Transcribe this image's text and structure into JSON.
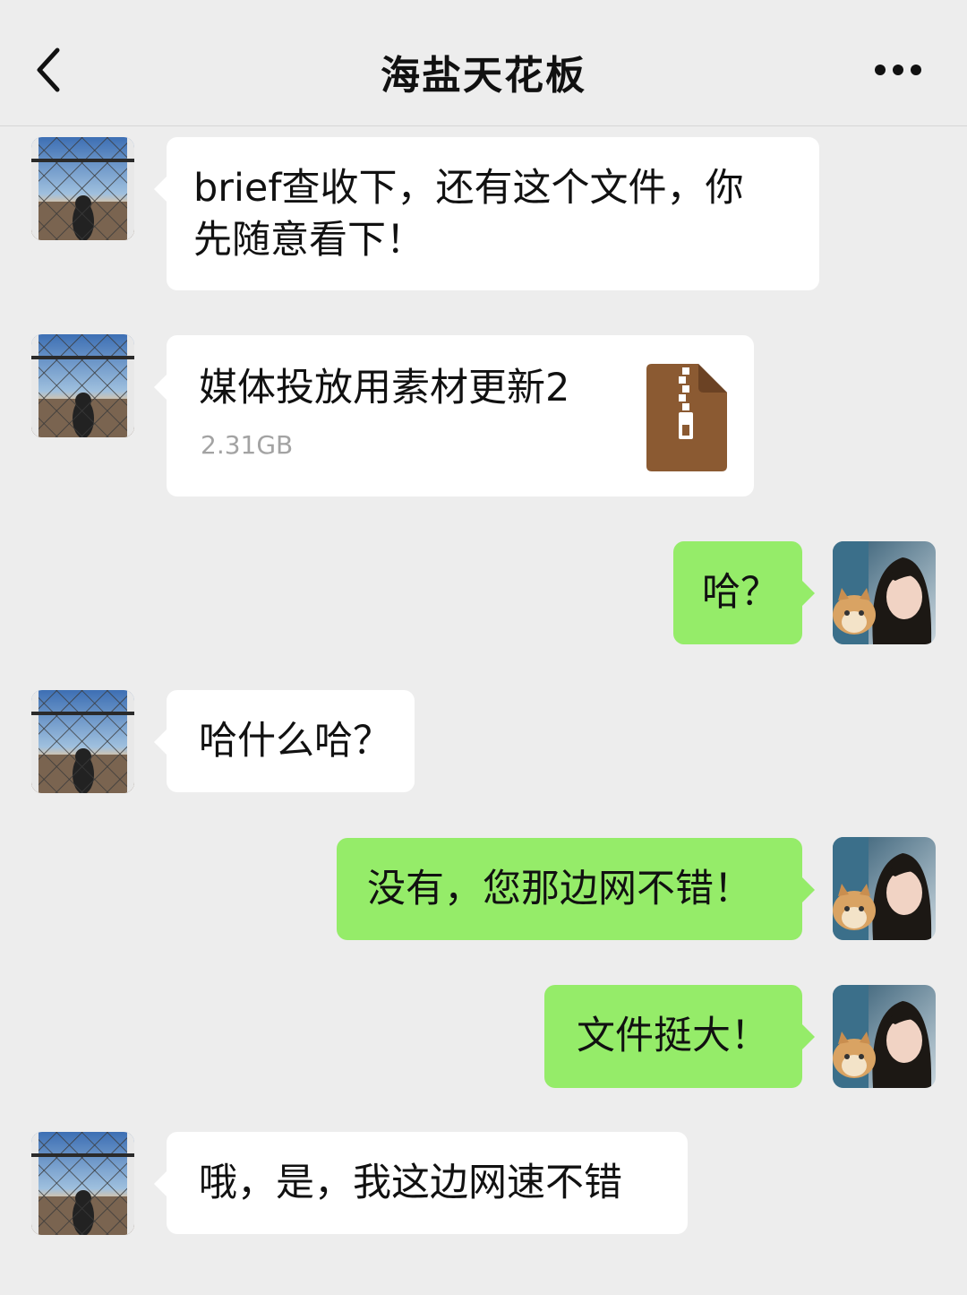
{
  "header": {
    "title": "海盐天花板"
  },
  "icons": {
    "back": "chevron-left-icon",
    "more": "more-dots-icon",
    "file": "zip-file-icon"
  },
  "colors": {
    "background": "#ededed",
    "incoming_bubble": "#ffffff",
    "outgoing_bubble": "#95ec69",
    "file_icon": "#8b5a32"
  },
  "messages": [
    {
      "side": "left",
      "type": "text",
      "lines": [
        "brief查收下，还有这个文件，你",
        "先随意看下！"
      ]
    },
    {
      "side": "left",
      "type": "file",
      "file_name": "媒体投放用素材更新2",
      "file_size": "2.31GB"
    },
    {
      "side": "right",
      "type": "text",
      "text": "哈？"
    },
    {
      "side": "left",
      "type": "text",
      "text": "哈什么哈？"
    },
    {
      "side": "right",
      "type": "text",
      "text": "没有，您那边网不错！"
    },
    {
      "side": "right",
      "type": "text",
      "text": "文件挺大！"
    },
    {
      "side": "left",
      "type": "text",
      "text": "哦，是，我这边网速不错"
    }
  ]
}
